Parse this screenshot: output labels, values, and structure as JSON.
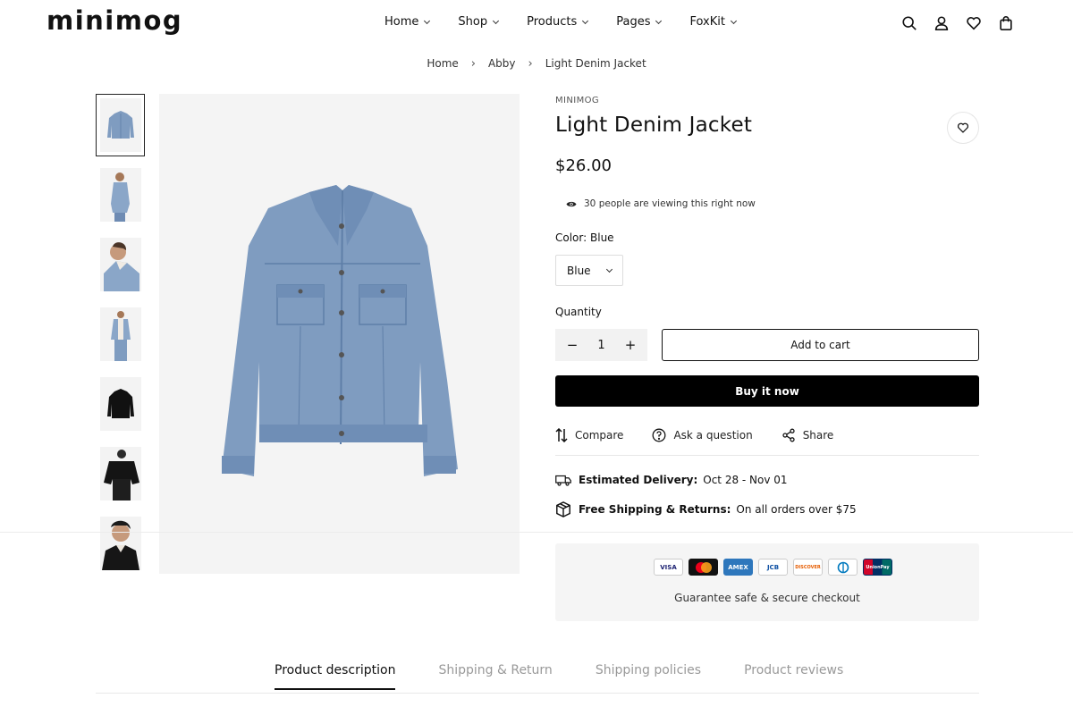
{
  "header": {
    "logo": "minimog",
    "nav": [
      {
        "label": "Home"
      },
      {
        "label": "Shop"
      },
      {
        "label": "Products"
      },
      {
        "label": "Pages"
      },
      {
        "label": "FoxKit"
      }
    ],
    "icons": [
      "search-icon",
      "account-icon",
      "wishlist-icon",
      "cart-icon"
    ]
  },
  "breadcrumb": [
    "Home",
    "Abby",
    "Light Denim Jacket"
  ],
  "gallery": {
    "thumbnail_count": 7,
    "active_index": 0
  },
  "product": {
    "vendor": "MINIMOG",
    "title": "Light Denim Jacket",
    "price": "$26.00",
    "viewers": "30 people are viewing this right now",
    "color_label": "Color:",
    "color_value": "Blue",
    "color_option": "Blue",
    "quantity_label": "Quantity",
    "quantity": "1",
    "qty_minus": "−",
    "qty_plus": "+",
    "add_to_cart": "Add to cart",
    "buy_now": "Buy it now",
    "actions": {
      "compare": "Compare",
      "ask": "Ask a question",
      "share": "Share"
    },
    "delivery": {
      "label": "Estimated Delivery:",
      "value": "Oct 28 - Nov 01"
    },
    "shipping": {
      "label": "Free Shipping & Returns:",
      "value": "On all orders over $75"
    }
  },
  "guarantee": {
    "cards": [
      "VISA",
      "mastercard",
      "AMEX",
      "JCB",
      "DISCOVER",
      "Diners",
      "UnionPay"
    ],
    "text": "Guarantee safe & secure checkout"
  },
  "tabs": [
    {
      "label": "Product description",
      "active": true
    },
    {
      "label": "Shipping & Return",
      "active": false
    },
    {
      "label": "Shipping policies",
      "active": false
    },
    {
      "label": "Product reviews",
      "active": false
    }
  ],
  "colors": {
    "denim": "#7f9cc0",
    "denim_dark": "#5f7fa8",
    "black": "#000000"
  }
}
